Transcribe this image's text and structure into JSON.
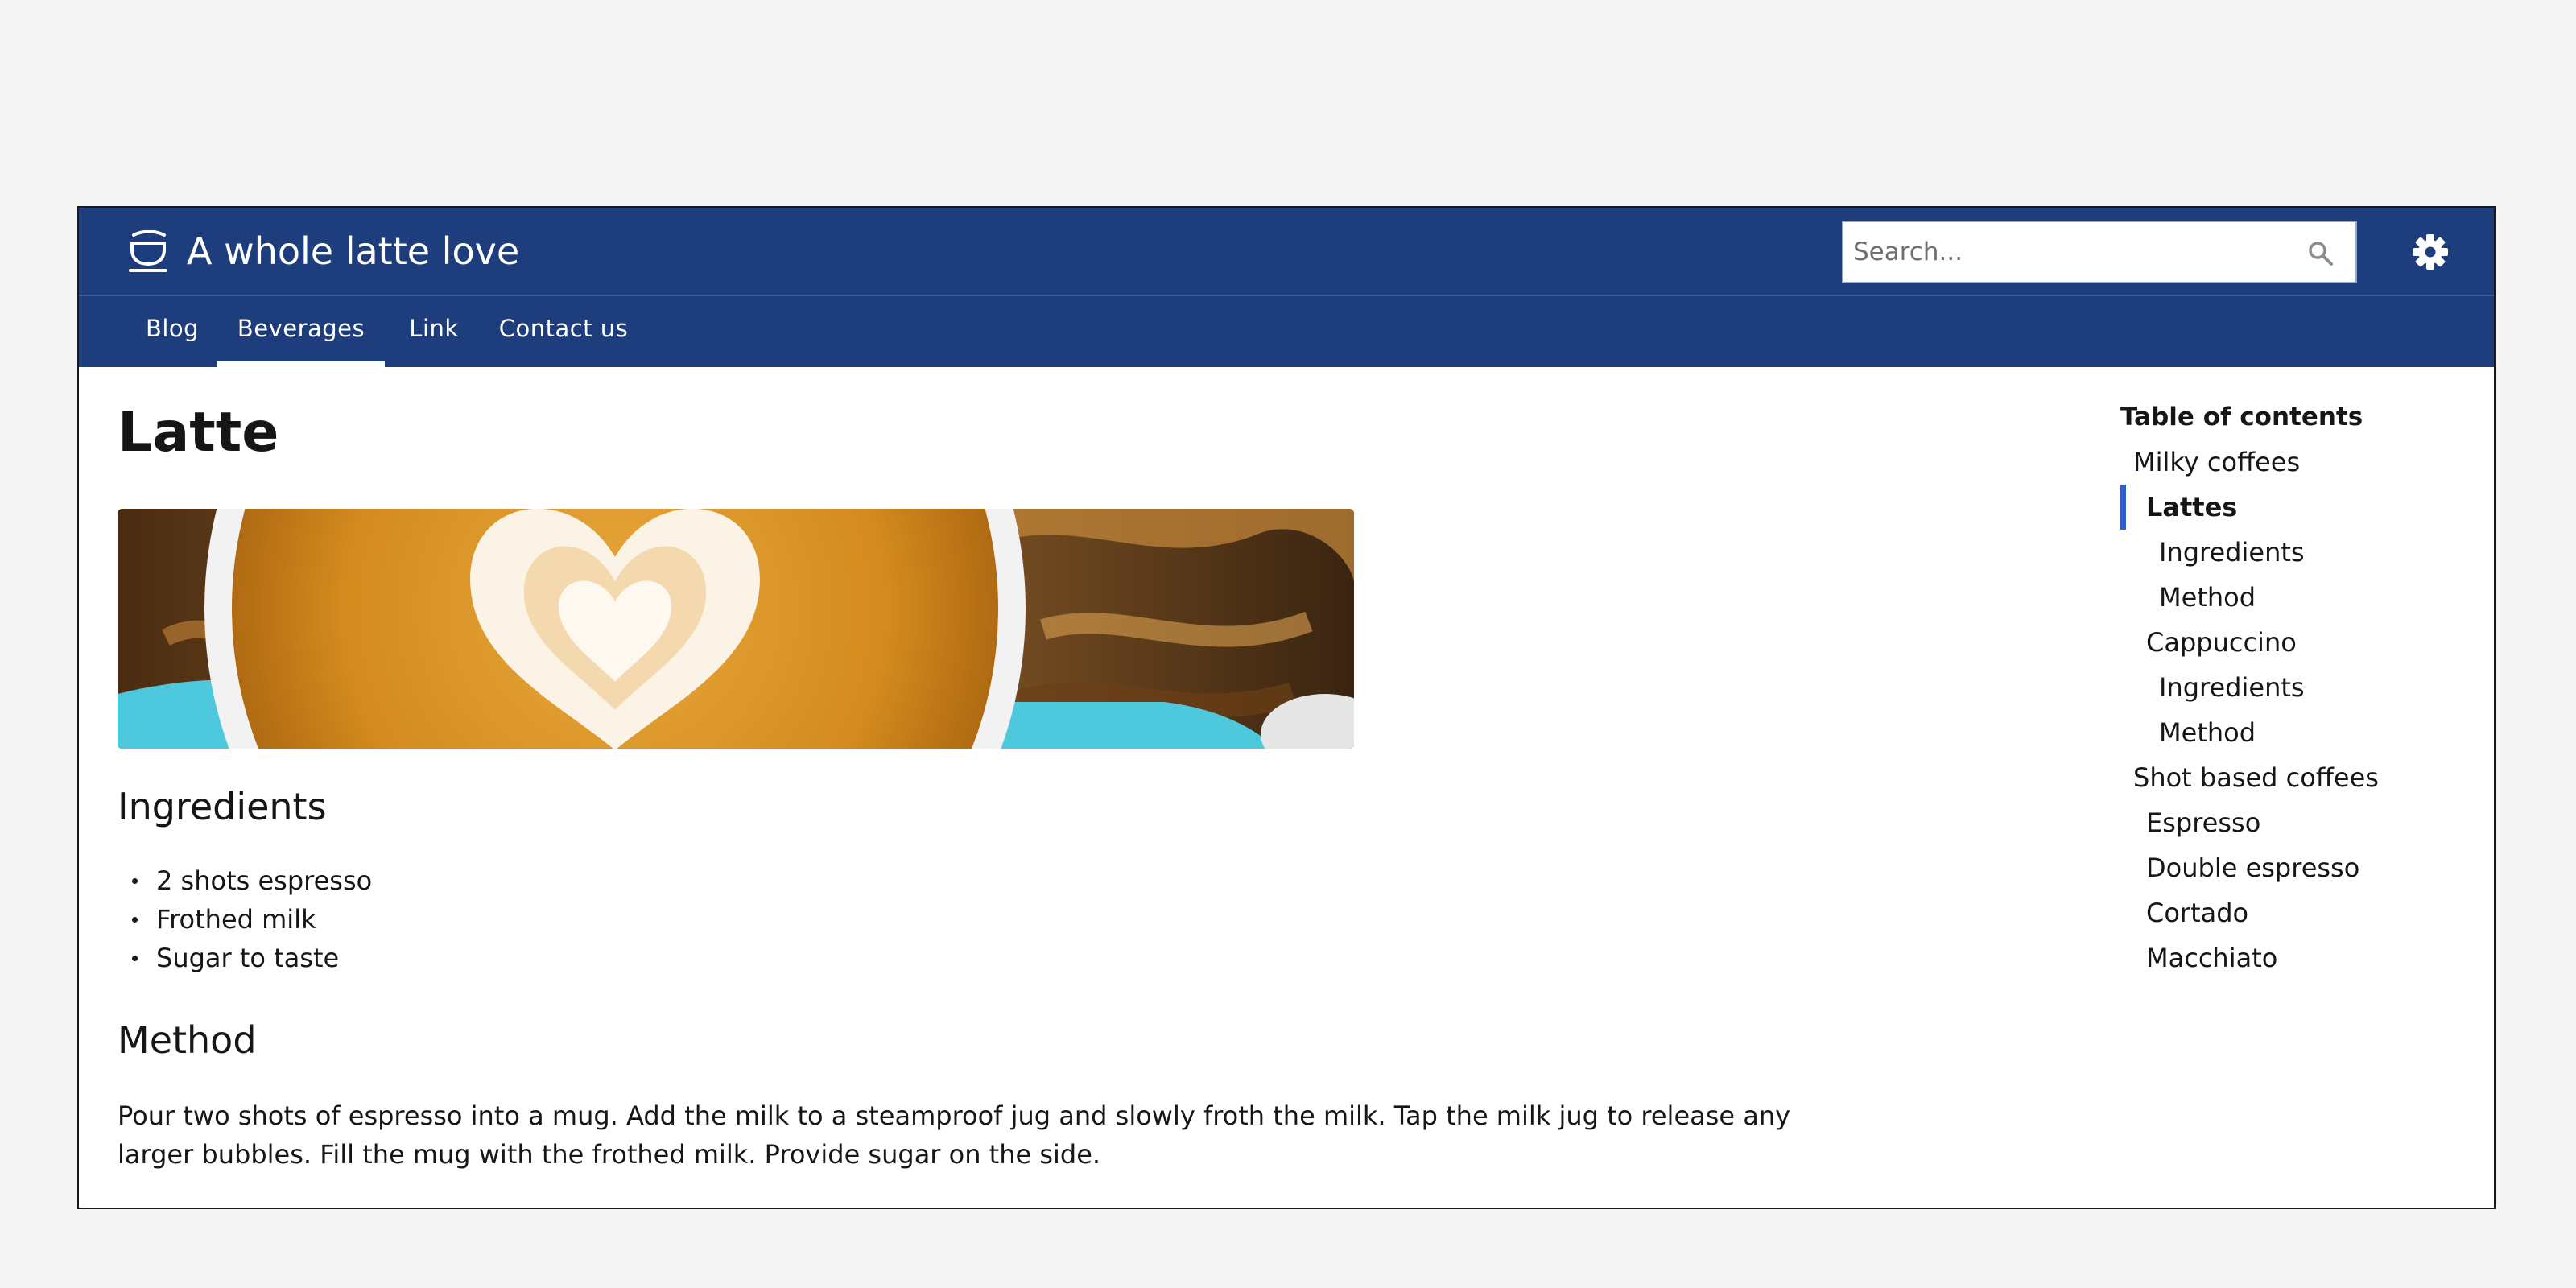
{
  "header": {
    "site_title": "A whole latte love",
    "logo_icon": "coffee-cup-icon",
    "search_placeholder": "Search...",
    "search_icon": "search-icon",
    "settings_icon": "gear-icon",
    "brand_color": "#1e3d7c"
  },
  "nav": {
    "items": [
      {
        "label": "Blog",
        "active": false
      },
      {
        "label": "Beverages",
        "active": true
      },
      {
        "label": "Link",
        "active": false
      },
      {
        "label": "Contact us",
        "active": false
      }
    ]
  },
  "article": {
    "title": "Latte",
    "ingredients_heading": "Ingredients",
    "ingredients": [
      "2 shots espresso",
      "Frothed milk",
      "Sugar to taste"
    ],
    "method_heading": "Method",
    "method_text": "Pour two shots of espresso into a mug. Add the milk to a steamproof jug and slowly froth the milk. Tap the milk jug to release any larger bubbles. Fill the mug with the frothed milk. Provide sugar on the side."
  },
  "toc": {
    "title": "Table of contents",
    "items": [
      {
        "label": "Milky coffees",
        "level": 1
      },
      {
        "label": "Lattes",
        "level": 2,
        "active": true
      },
      {
        "label": "Ingredients",
        "level": 3
      },
      {
        "label": "Method",
        "level": 3
      },
      {
        "label": "Cappuccino",
        "level": 2
      },
      {
        "label": "Ingredients",
        "level": 3
      },
      {
        "label": "Method",
        "level": 3
      },
      {
        "label": "Shot based coffees",
        "level": 1
      },
      {
        "label": "Espresso",
        "level": 2
      },
      {
        "label": "Double espresso",
        "level": 2
      },
      {
        "label": "Cortado",
        "level": 2
      },
      {
        "label": "Macchiato",
        "level": 2
      }
    ],
    "accent_color": "#2f5fc7"
  }
}
